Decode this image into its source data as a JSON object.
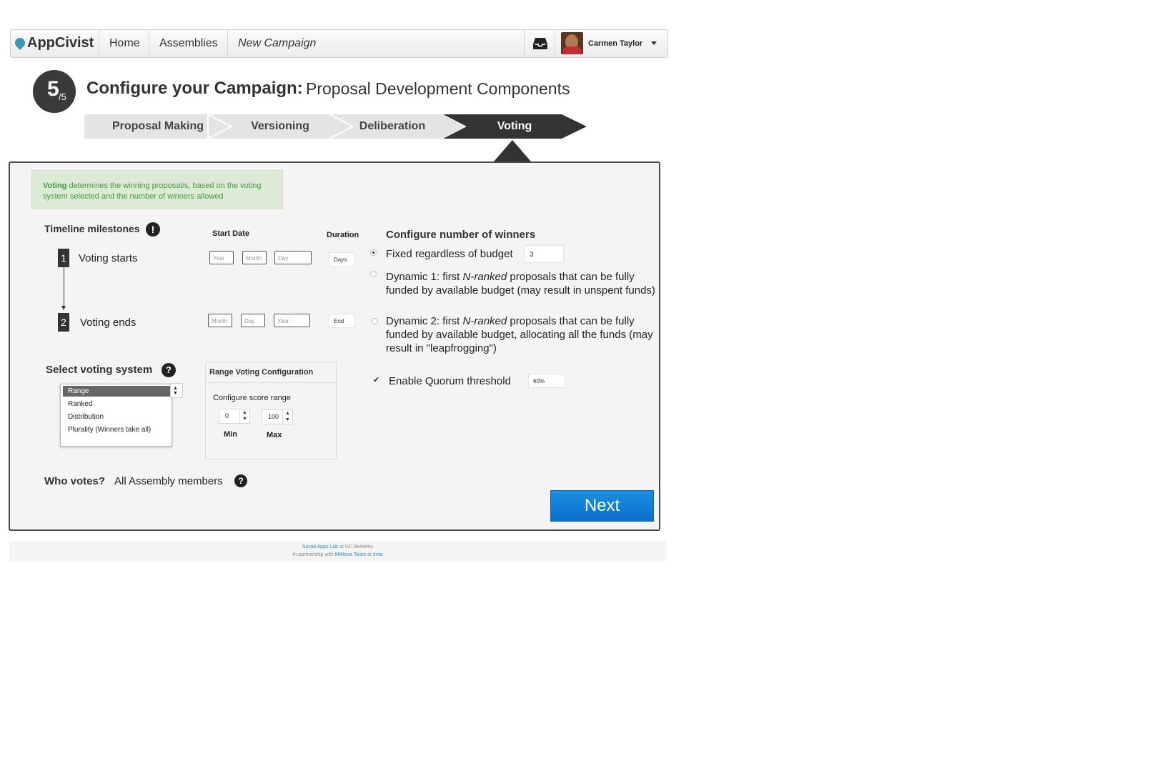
{
  "nav": {
    "logo": "AppCivist",
    "home": "Home",
    "assemblies": "Assemblies",
    "current": "New Campaign",
    "user_name": "Carmen Taylor"
  },
  "header": {
    "step_number": "5",
    "step_total": "/5",
    "title_bold": "Configure your Campaign:",
    "title_light": "Proposal Development Components"
  },
  "stepper": {
    "steps": [
      "Proposal Making",
      "Versioning",
      "Deliberation",
      "Voting"
    ],
    "active_index": 3
  },
  "info": {
    "bold": "Voting",
    "text": " determines the winning proposal/s, based on the voting system selected and the number of winners allowed"
  },
  "timeline": {
    "title": "Timeline milestones",
    "start_date_header": "Start Date",
    "duration_header": "Duration",
    "milestones": [
      {
        "num": "1",
        "label": "Voting starts",
        "fields": [
          "Year",
          "Month",
          "Day"
        ],
        "duration": "Days"
      },
      {
        "num": "2",
        "label": "Voting ends",
        "fields": [
          "Month",
          "Day",
          "Year"
        ],
        "duration": "End"
      }
    ]
  },
  "winners": {
    "title": "Configure number of winners",
    "fixed_label": "Fixed regardless of budget",
    "fixed_value": "3",
    "dynamic1_pre": "Dynamic 1: first ",
    "dynamic1_em": "N-ranked",
    "dynamic1_post": " proposals that can be fully",
    "dynamic1_line2": "funded by available budget (may result in unspent funds)",
    "dynamic2_pre": "Dynamic 2: first ",
    "dynamic2_em": "N-ranked",
    "dynamic2_post": " proposals that can be fully",
    "dynamic2_line2": "funded by available budget, allocating all the funds (may",
    "dynamic2_line3": "result in \"leapfrogging\")",
    "selected": "fixed"
  },
  "quorum": {
    "label": "Enable Quorum threshold",
    "value": "60%",
    "checked": true
  },
  "voting_system": {
    "title": "Select voting system",
    "options": [
      "Range",
      "Ranked",
      "Distribution",
      "Plurality (Winners take all)"
    ],
    "selected": "Range"
  },
  "range_config": {
    "title": "Range Voting Configuration",
    "subtitle": "Configure score range",
    "min_value": "0",
    "max_value": "100",
    "min_label": "Min",
    "max_label": "Max"
  },
  "who_votes": {
    "label": "Who votes?",
    "value": "All Assembly members"
  },
  "next_label": "Next",
  "footer": {
    "lab": "Social Apps Lab",
    "at1": " at UC Berkeley",
    "partner_pre": "In partnership with ",
    "team": "MiMove Team",
    "at2": " at ",
    "inria": "Inria"
  },
  "colors": {
    "accent": "#0a6fc9",
    "info_bg": "#ddebd6",
    "info_text": "#3f9b3f",
    "stepper_active": "#333333",
    "stepper_inactive": "#e4e4e4"
  },
  "icons": {
    "logo": "drop-icon",
    "inbox": "inbox-icon",
    "dropdown": "caret-down-icon",
    "alert": "exclamation-circle-icon",
    "help": "question-circle-icon"
  }
}
